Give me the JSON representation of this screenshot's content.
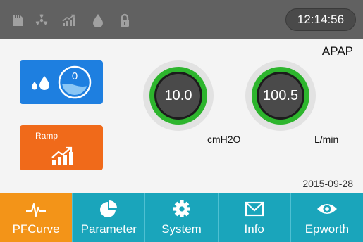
{
  "status_bar": {
    "icons": [
      "sd-card-icon",
      "hazard-icon",
      "signal-trend-icon",
      "water-drop-icon",
      "lock-icon"
    ],
    "time": "12:14:56"
  },
  "mode": "APAP",
  "humidifier": {
    "level": "0"
  },
  "ramp": {
    "label": "Ramp"
  },
  "gauges": {
    "pressure": {
      "value": "10.0",
      "unit": "cmH2O"
    },
    "flow": {
      "value": "100.5",
      "unit": "L/min"
    }
  },
  "date": "2015-09-28",
  "tabs": [
    {
      "label": "PFCurve",
      "icon": "waveform-icon",
      "active": true
    },
    {
      "label": "Parameter",
      "icon": "pie-chart-icon",
      "active": false
    },
    {
      "label": "System",
      "icon": "gear-icon",
      "active": false
    },
    {
      "label": "Info",
      "icon": "envelope-icon",
      "active": false
    },
    {
      "label": "Epworth",
      "icon": "eye-icon",
      "active": false
    }
  ],
  "colors": {
    "status_bar": "#616161",
    "humidifier_button": "#1e7fe0",
    "ramp_button": "#f06a1a",
    "tab_bar": "#1aa5bb",
    "tab_active": "#f39418",
    "gauge_ring": "#2db52d",
    "gauge_face": "#4a4a4a"
  }
}
